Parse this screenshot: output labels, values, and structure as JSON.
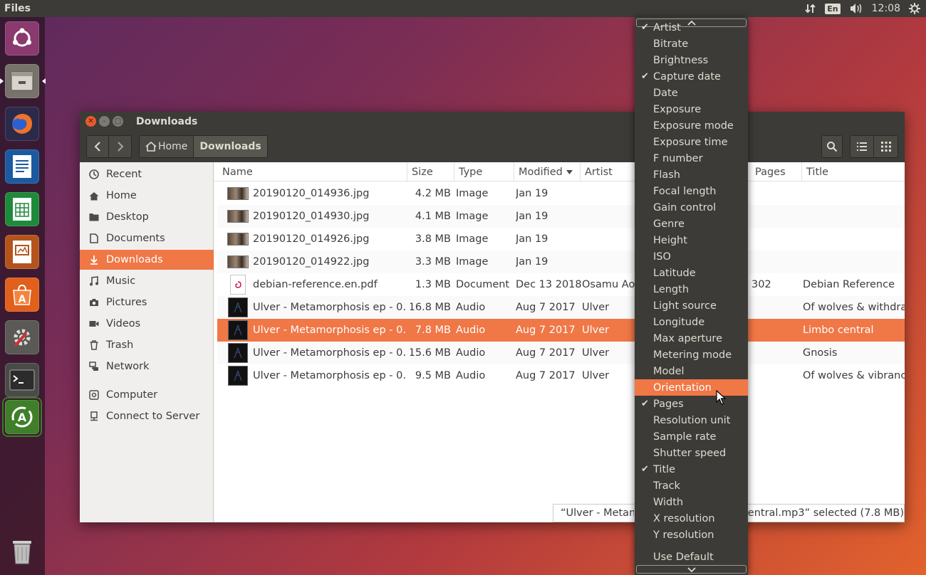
{
  "topbar": {
    "app_title": "Files",
    "lang": "En",
    "time": "12:08",
    "icons": [
      "network-updown-icon",
      "keyboard-lang-icon",
      "volume-icon",
      "power-gear-icon"
    ]
  },
  "launcher": {
    "items": [
      "ubuntu-dash-icon",
      "files-icon",
      "firefox-icon",
      "libreoffice-writer-icon",
      "libreoffice-calc-icon",
      "libreoffice-impress-icon",
      "software-center-icon",
      "system-settings-icon",
      "terminal-icon",
      "software-updater-icon",
      "trash-icon"
    ]
  },
  "window": {
    "title": "Downloads",
    "breadcrumb": {
      "home": "Home",
      "current": "Downloads"
    },
    "sidebar": [
      {
        "label": "Recent",
        "icon": "clock-icon"
      },
      {
        "label": "Home",
        "icon": "home-icon"
      },
      {
        "label": "Desktop",
        "icon": "folder-icon"
      },
      {
        "label": "Documents",
        "icon": "document-icon"
      },
      {
        "label": "Downloads",
        "icon": "download-icon",
        "active": true
      },
      {
        "label": "Music",
        "icon": "music-icon"
      },
      {
        "label": "Pictures",
        "icon": "camera-icon"
      },
      {
        "label": "Videos",
        "icon": "video-icon"
      },
      {
        "label": "Trash",
        "icon": "trash-icon"
      },
      {
        "label": "Network",
        "icon": "network-icon"
      },
      {
        "label": "Computer",
        "icon": "computer-icon"
      },
      {
        "label": "Connect to Server",
        "icon": "server-icon"
      }
    ],
    "columns": [
      "Name",
      "Size",
      "Type",
      "Modified",
      "Artist",
      "Pages",
      "Title"
    ],
    "rows": [
      {
        "name": "20190120_014936.jpg",
        "size": "4.2 MB",
        "type": "Image",
        "modified": "Jan 19",
        "artist": "",
        "pages": "",
        "title": "",
        "kind": "image"
      },
      {
        "name": "20190120_014930.jpg",
        "size": "4.1 MB",
        "type": "Image",
        "modified": "Jan 19",
        "artist": "",
        "pages": "",
        "title": "",
        "kind": "image"
      },
      {
        "name": "20190120_014926.jpg",
        "size": "3.8 MB",
        "type": "Image",
        "modified": "Jan 19",
        "artist": "",
        "pages": "",
        "title": "",
        "kind": "image"
      },
      {
        "name": "20190120_014922.jpg",
        "size": "3.3 MB",
        "type": "Image",
        "modified": "Jan 19",
        "artist": "",
        "pages": "",
        "title": "",
        "kind": "image"
      },
      {
        "name": "debian-reference.en.pdf",
        "size": "1.3 MB",
        "type": "Document",
        "modified": "Dec 13 2018",
        "artist": "Osamu Ao",
        "pages": "302",
        "title": "Debian Reference",
        "kind": "pdf"
      },
      {
        "name": "Ulver - Metamorphosis ep - 0…",
        "size": "16.8 MB",
        "type": "Audio",
        "modified": "Aug 7 2017",
        "artist": "Ulver",
        "pages": "",
        "title": "Of wolves & withdra",
        "kind": "audio"
      },
      {
        "name": "Ulver - Metamorphosis ep - 0…",
        "size": "7.8 MB",
        "type": "Audio",
        "modified": "Aug 7 2017",
        "artist": "Ulver",
        "pages": "",
        "title": "Limbo central",
        "kind": "audio",
        "selected": true
      },
      {
        "name": "Ulver - Metamorphosis ep - 0…",
        "size": "15.6 MB",
        "type": "Audio",
        "modified": "Aug 7 2017",
        "artist": "Ulver",
        "pages": "",
        "title": "Gnosis",
        "kind": "audio"
      },
      {
        "name": "Ulver - Metamorphosis ep - 0…",
        "size": "9.5 MB",
        "type": "Audio",
        "modified": "Aug 7 2017",
        "artist": "Ulver",
        "pages": "",
        "title": "Of wolves & vibrancy",
        "kind": "audio"
      }
    ],
    "status": {
      "left": "“Ulver - Metamo",
      "right": "entral.mp3” selected  (7.8 MB)"
    }
  },
  "menu": {
    "items": [
      {
        "label": "Artist",
        "checked": true
      },
      {
        "label": "Bitrate"
      },
      {
        "label": "Brightness"
      },
      {
        "label": "Capture date",
        "checked": true
      },
      {
        "label": "Date"
      },
      {
        "label": "Exposure"
      },
      {
        "label": "Exposure mode"
      },
      {
        "label": "Exposure time"
      },
      {
        "label": "F number"
      },
      {
        "label": "Flash"
      },
      {
        "label": "Focal length"
      },
      {
        "label": "Gain control"
      },
      {
        "label": "Genre"
      },
      {
        "label": "Height"
      },
      {
        "label": "ISO"
      },
      {
        "label": "Latitude"
      },
      {
        "label": "Length"
      },
      {
        "label": "Light source"
      },
      {
        "label": "Longitude"
      },
      {
        "label": "Max aperture"
      },
      {
        "label": "Metering mode"
      },
      {
        "label": "Model"
      },
      {
        "label": "Orientation",
        "hover": true
      },
      {
        "label": "Pages",
        "checked": true
      },
      {
        "label": "Resolution unit"
      },
      {
        "label": "Sample rate"
      },
      {
        "label": "Shutter speed"
      },
      {
        "label": "Title",
        "checked": true
      },
      {
        "label": "Track"
      },
      {
        "label": "Width"
      },
      {
        "label": "X resolution"
      },
      {
        "label": "Y resolution"
      }
    ],
    "use_default": "Use Default"
  },
  "colors": {
    "accent": "#f07746",
    "panel": "#3c3b37",
    "text_light": "#dfdbd2"
  }
}
